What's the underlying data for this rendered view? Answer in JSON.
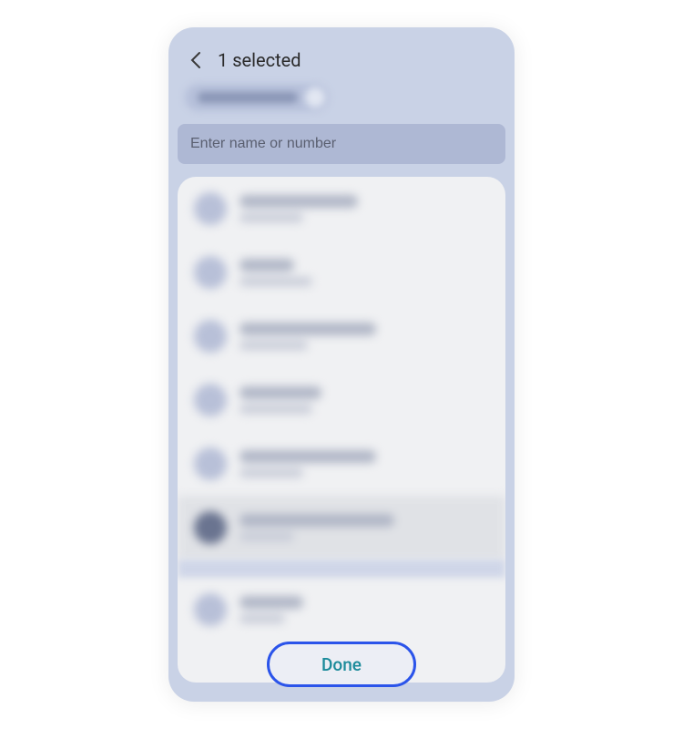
{
  "header": {
    "title": "1 selected"
  },
  "search": {
    "placeholder": "Enter name or number"
  },
  "contacts": [
    {
      "nameWidth": 130,
      "subWidth": 70,
      "selected": false,
      "dark": false
    },
    {
      "nameWidth": 60,
      "subWidth": 80,
      "selected": false,
      "dark": false
    },
    {
      "nameWidth": 150,
      "subWidth": 75,
      "selected": false,
      "dark": false
    },
    {
      "nameWidth": 90,
      "subWidth": 80,
      "selected": false,
      "dark": false
    },
    {
      "nameWidth": 150,
      "subWidth": 70,
      "selected": false,
      "dark": false
    },
    {
      "nameWidth": 170,
      "subWidth": 60,
      "selected": true,
      "dark": true
    }
  ],
  "extraContact": {
    "nameWidth": 70,
    "subWidth": 50
  },
  "doneButton": {
    "label": "Done"
  },
  "colors": {
    "highlightBorder": "#2b54ea",
    "accentText": "#1a8a9a"
  }
}
